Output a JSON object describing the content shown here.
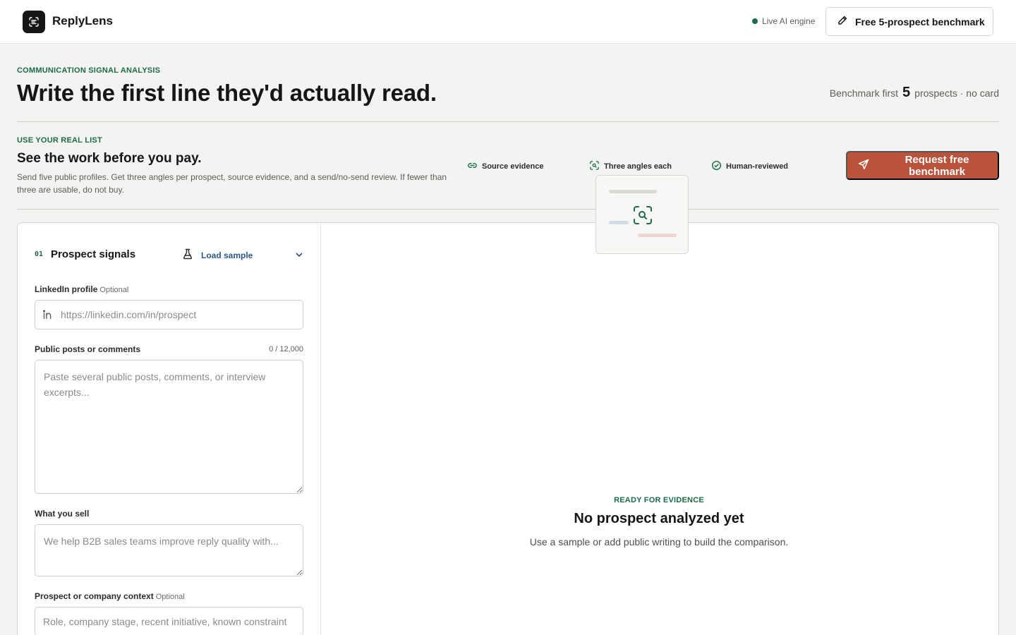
{
  "header": {
    "brand": "ReplyLens",
    "status": "Live AI engine",
    "benchmark_button": "Free 5-prospect benchmark"
  },
  "hero": {
    "eyebrow": "COMMUNICATION SIGNAL ANALYSIS",
    "title": "Write the first line they'd actually read.",
    "meta_prefix": "Benchmark first",
    "meta_number": "5",
    "meta_suffix": "prospects · no card"
  },
  "benchmark": {
    "eyebrow": "USE YOUR REAL LIST",
    "title": "See the work before you pay.",
    "description": "Send five public profiles. Get three angles per prospect, source evidence, and a send/no-send review. If fewer than three are usable, do not buy.",
    "features": [
      {
        "label": "Source evidence",
        "icon": "link-icon"
      },
      {
        "label": "Three angles each",
        "icon": "scan-icon"
      },
      {
        "label": "Human-reviewed",
        "icon": "check-circle-icon"
      }
    ],
    "cta": "Request free benchmark"
  },
  "form": {
    "step": "01",
    "title": "Prospect signals",
    "load_sample": "Load sample",
    "linkedin": {
      "label": "LinkedIn profile",
      "optional": "Optional",
      "placeholder": "https://linkedin.com/in/prospect"
    },
    "posts": {
      "label": "Public posts or comments",
      "counter": "0 / 12,000",
      "placeholder": "Paste several public posts, comments, or interview excerpts..."
    },
    "sell": {
      "label": "What you sell",
      "placeholder": "We help B2B sales teams improve reply quality with..."
    },
    "context": {
      "label": "Prospect or company context",
      "optional": "Optional",
      "placeholder": "Role, company stage, recent initiative, known constraint"
    }
  },
  "empty_state": {
    "eyebrow": "READY FOR EVIDENCE",
    "title": "No prospect analyzed yet",
    "description": "Use a sample or add public writing to build the comparison."
  },
  "colors": {
    "accent_green": "#1b6b4a",
    "cta": "#b9533a",
    "link_blue": "#2b5a8a",
    "background": "#f3f4f1"
  }
}
